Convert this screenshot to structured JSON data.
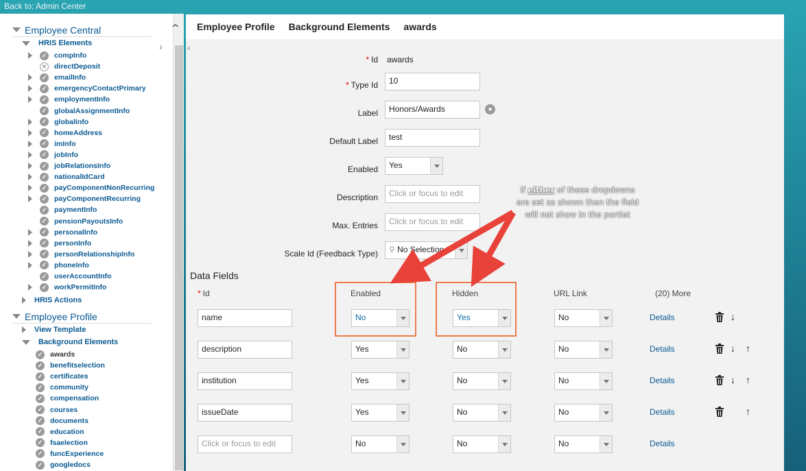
{
  "back_link": "Back to: Admin Center",
  "tree": {
    "employee_central": "Employee Central",
    "hris_elements": "HRIS Elements",
    "hris_items": [
      "compInfo",
      "directDeposit",
      "emailInfo",
      "emergencyContactPrimary",
      "employmentInfo",
      "globalAssignmentInfo",
      "globalInfo",
      "homeAddress",
      "imInfo",
      "jobInfo",
      "jobRelationsInfo",
      "nationalIdCard",
      "payComponentNonRecurring",
      "payComponentRecurring",
      "paymentInfo",
      "pensionPayoutsInfo",
      "personalInfo",
      "personInfo",
      "personRelationshipInfo",
      "phoneInfo",
      "userAccountInfo",
      "workPermitInfo"
    ],
    "hris_actions": "HRIS Actions",
    "employee_profile": "Employee Profile",
    "view_template": "View Template",
    "background_elements": "Background Elements",
    "bg_items": [
      "awards",
      "benefitselection",
      "certificates",
      "community",
      "compensation",
      "courses",
      "documents",
      "education",
      "fsaelection",
      "funcExperience",
      "googledocs"
    ]
  },
  "header": {
    "crumb1": "Employee Profile",
    "crumb2": "Background Elements",
    "crumb3": "awards"
  },
  "form": {
    "id_label": "Id",
    "id_value": "awards",
    "type_id_label": "Type Id",
    "type_id_value": "10",
    "label_label": "Label",
    "label_value": "Honors/Awards",
    "default_label_label": "Default Label",
    "default_label_value": "test",
    "enabled_label": "Enabled",
    "enabled_value": "Yes",
    "description_label": "Description",
    "description_placeholder": "Click or focus to edit",
    "max_entries_label": "Max. Entries",
    "max_entries_placeholder": "Click or focus to edit",
    "scale_id_label": "Scale Id (Feedback Type)",
    "scale_id_value": "No Selection"
  },
  "data_fields": {
    "title": "Data Fields",
    "columns": {
      "id": "Id",
      "enabled": "Enabled",
      "hidden": "Hidden",
      "url_link": "URL Link",
      "more": "(20) More"
    },
    "rows": [
      {
        "id": "name",
        "enabled": "No",
        "hidden": "Yes",
        "url": "No",
        "details": "Details"
      },
      {
        "id": "description",
        "enabled": "Yes",
        "hidden": "No",
        "url": "No",
        "details": "Details"
      },
      {
        "id": "institution",
        "enabled": "Yes",
        "hidden": "No",
        "url": "No",
        "details": "Details"
      },
      {
        "id": "issueDate",
        "enabled": "Yes",
        "hidden": "No",
        "url": "No",
        "details": "Details"
      },
      {
        "id_placeholder": "Click or focus to edit",
        "enabled": "No",
        "hidden": "No",
        "url": "No",
        "details": "Details"
      }
    ]
  },
  "annotation": {
    "pre": "If ",
    "emph": "either",
    "post": " of these dropdowns are set as shown then the field will not show in the portlet",
    "color": "#e8423a"
  }
}
